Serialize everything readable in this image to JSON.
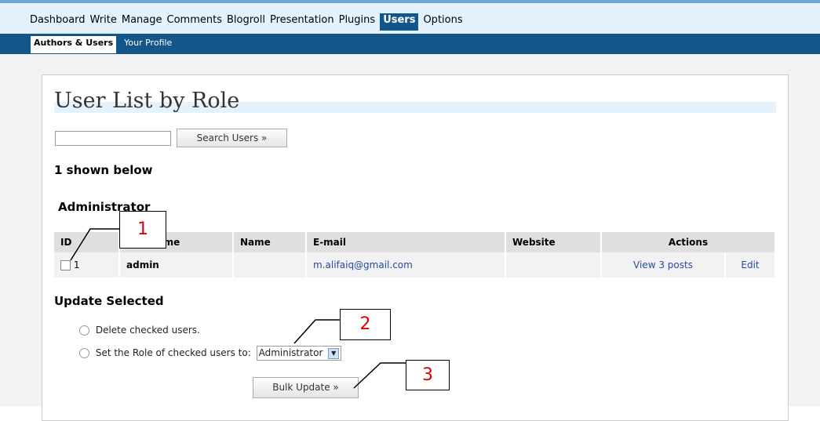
{
  "nav": {
    "main": [
      "Dashboard",
      "Write",
      "Manage",
      "Comments",
      "Blogroll",
      "Presentation",
      "Plugins",
      "Users",
      "Options"
    ],
    "active_main": "Users",
    "sub": [
      "Authors & Users",
      "Your Profile"
    ],
    "active_sub": "Authors & Users"
  },
  "page": {
    "title": "User List by Role",
    "search_button": "Search Users »",
    "shown_text": "1 shown below",
    "role_heading": "Administrator"
  },
  "table": {
    "headers": [
      "ID",
      "Username",
      "Name",
      "E-mail",
      "Website",
      "Actions"
    ],
    "rows": [
      {
        "id": "1",
        "username": "admin",
        "name": "",
        "email": "m.alifaiq@gmail.com",
        "website": "",
        "view_posts": "View 3 posts",
        "edit": "Edit"
      }
    ]
  },
  "update": {
    "heading": "Update Selected",
    "option_delete": "Delete checked users.",
    "option_role": "Set the Role of checked users to:",
    "role_selected": "Administrator",
    "bulk_button": "Bulk Update »"
  },
  "callouts": [
    "1",
    "2",
    "3"
  ]
}
